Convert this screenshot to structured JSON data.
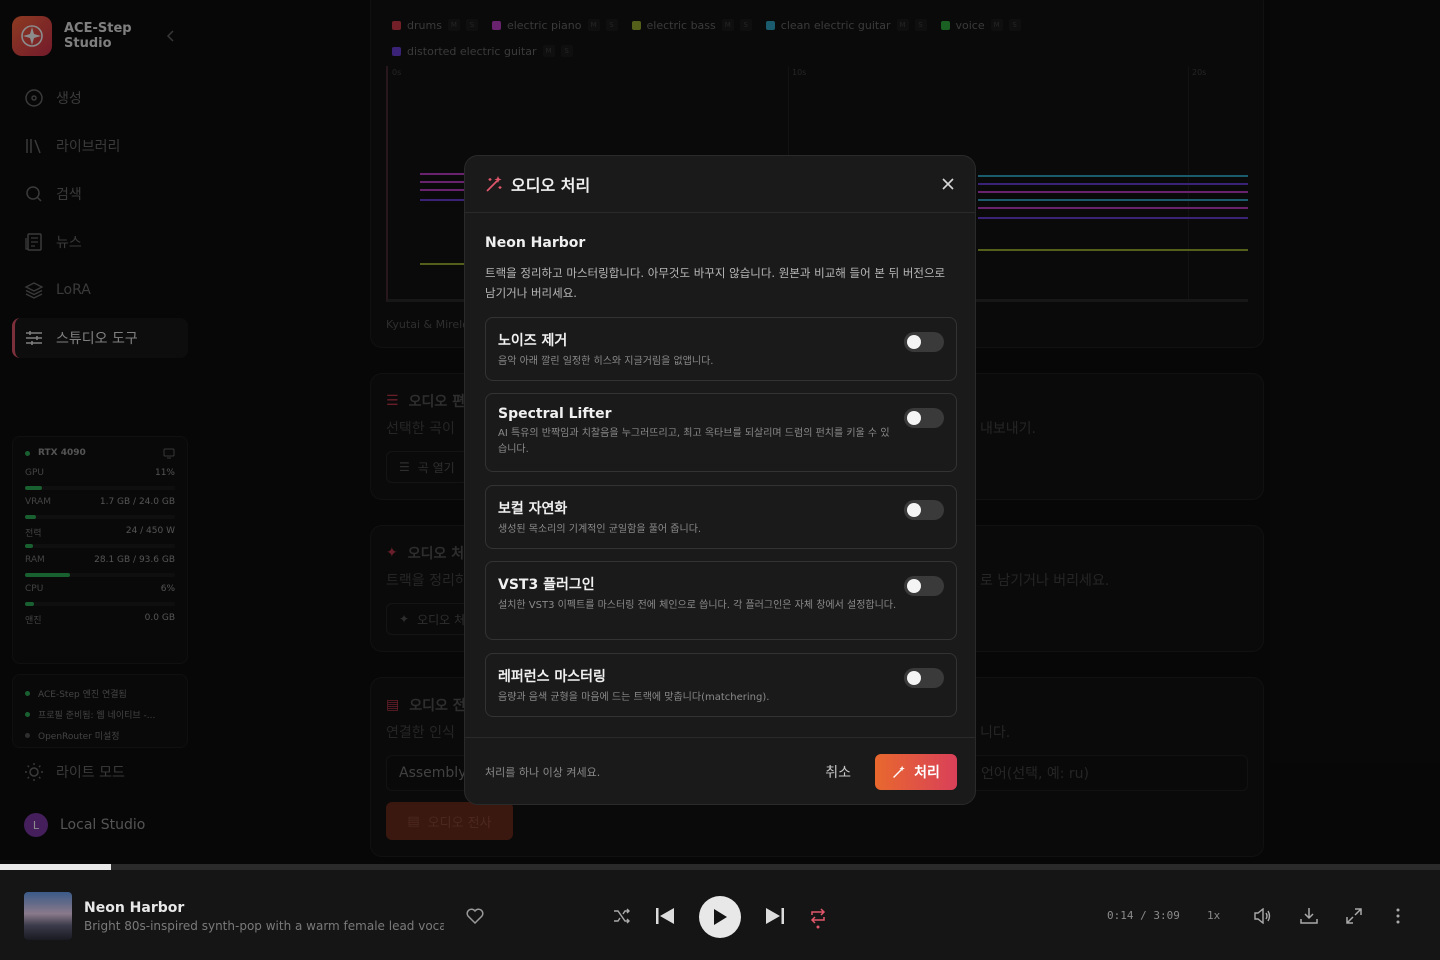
{
  "app": {
    "name": "ACE-Step Studio"
  },
  "sidebar": {
    "items": [
      {
        "label": "생성",
        "icon": "disc-icon"
      },
      {
        "label": "라이브러리",
        "icon": "library-icon"
      },
      {
        "label": "검색",
        "icon": "search-icon"
      },
      {
        "label": "뉴스",
        "icon": "newspaper-icon"
      },
      {
        "label": "LoRA",
        "icon": "layers-icon"
      },
      {
        "label": "스튜디오 도구",
        "icon": "sliders-icon",
        "active": true
      }
    ],
    "gpu": {
      "name": "RTX 4090",
      "metrics": [
        {
          "label": "GPU",
          "value": "11%",
          "fraction": 0.11
        },
        {
          "label": "VRAM",
          "value": "1.7 GB / 24.0 GB",
          "fraction": 0.07
        },
        {
          "label": "전력",
          "value": "24 / 450 W",
          "fraction": 0.05
        },
        {
          "label": "RAM",
          "value": "28.1 GB / 93.6 GB",
          "fraction": 0.3
        },
        {
          "label": "CPU",
          "value": "6%",
          "fraction": 0.06
        },
        {
          "label": "앤진",
          "value": "0.0 GB"
        }
      ]
    },
    "status": [
      {
        "text": "ACE-Step 엔진 연결됨",
        "color": "#2fb05a"
      },
      {
        "text": "프로필 준비됨: 웹 네이티브 -...",
        "color": "#2fb05a"
      },
      {
        "text": "OpenRouter 미설정",
        "color": "#555555"
      }
    ],
    "light_mode": "라이트 모드",
    "user": {
      "initial": "L",
      "name": "Local Studio"
    }
  },
  "background": {
    "stems": [
      {
        "name": "drums",
        "color": "#d03a4a"
      },
      {
        "name": "electric piano",
        "color": "#c040c8"
      },
      {
        "name": "electric bass",
        "color": "#9ab030"
      },
      {
        "name": "clean electric guitar",
        "color": "#30a8c8"
      },
      {
        "name": "voice",
        "color": "#30b040"
      },
      {
        "name": "distorted electric guitar",
        "color": "#6a40d8"
      }
    ],
    "stem_mute": "M",
    "stem_solo": "S",
    "time_marks": [
      "0s",
      "10s",
      "20s"
    ],
    "credit": "Kyutai & Mirelo",
    "sections": [
      {
        "title": "오디오 편",
        "desc": "선택한 곡이",
        "desc_right": "내보내기.",
        "button": "곡 열기"
      },
      {
        "title": "오디오 처",
        "desc": "트랙을 정리하",
        "desc_right": "로 남기거나 버리세요.",
        "button": "오디오 처"
      },
      {
        "title": "오디오 전",
        "desc": "연결한 인식",
        "desc_right": "니다.",
        "input_left": "Assembly",
        "input_right": "언어(선택, 예: ru)",
        "button": "오디오 전사"
      }
    ]
  },
  "modal": {
    "title": "오디오 처리",
    "track": "Neon Harbor",
    "description": "트랙을 정리하고 마스터링합니다. 아무것도 바꾸지 않습니다. 원본과 비교해 들어 본 뒤 버전으로 남기거나 버리세요.",
    "options": [
      {
        "title": "노이즈 제거",
        "desc": "음악 아래 깔린 일정한 히스와 지글거림을 없앱니다.",
        "enabled": false
      },
      {
        "title": "Spectral Lifter",
        "desc": "AI 특유의 반짝임과 치찰음을 누그러뜨리고, 최고 옥타브를 되살리며 드럼의 펀치를 키울 수 있습니다.",
        "enabled": false
      },
      {
        "title": "보컬 자연화",
        "desc": "생성된 목소리의 기계적인 균일함을 풀어 줍니다.",
        "enabled": false
      },
      {
        "title": "VST3 플러그인",
        "desc": "설치한 VST3 이펙트를 마스터링 전에 체인으로 씁니다. 각 플러그인은 자체 창에서 설정합니다.",
        "enabled": false
      },
      {
        "title": "레퍼런스 마스터링",
        "desc": "음량과 음색 균형을 마음에 드는 트랙에 맞춥니다(matchering).",
        "enabled": false
      }
    ],
    "footer_hint": "처리를 하나 이상 켜세요.",
    "cancel": "취소",
    "process": "처리"
  },
  "player": {
    "title": "Neon Harbor",
    "subtitle": "Bright 80s-inspired synth-pop with a warm female lead vocal,...",
    "time": "0:14 / 3:09",
    "speed": "1x",
    "progress": 0.077,
    "accent": "#e0566b"
  }
}
